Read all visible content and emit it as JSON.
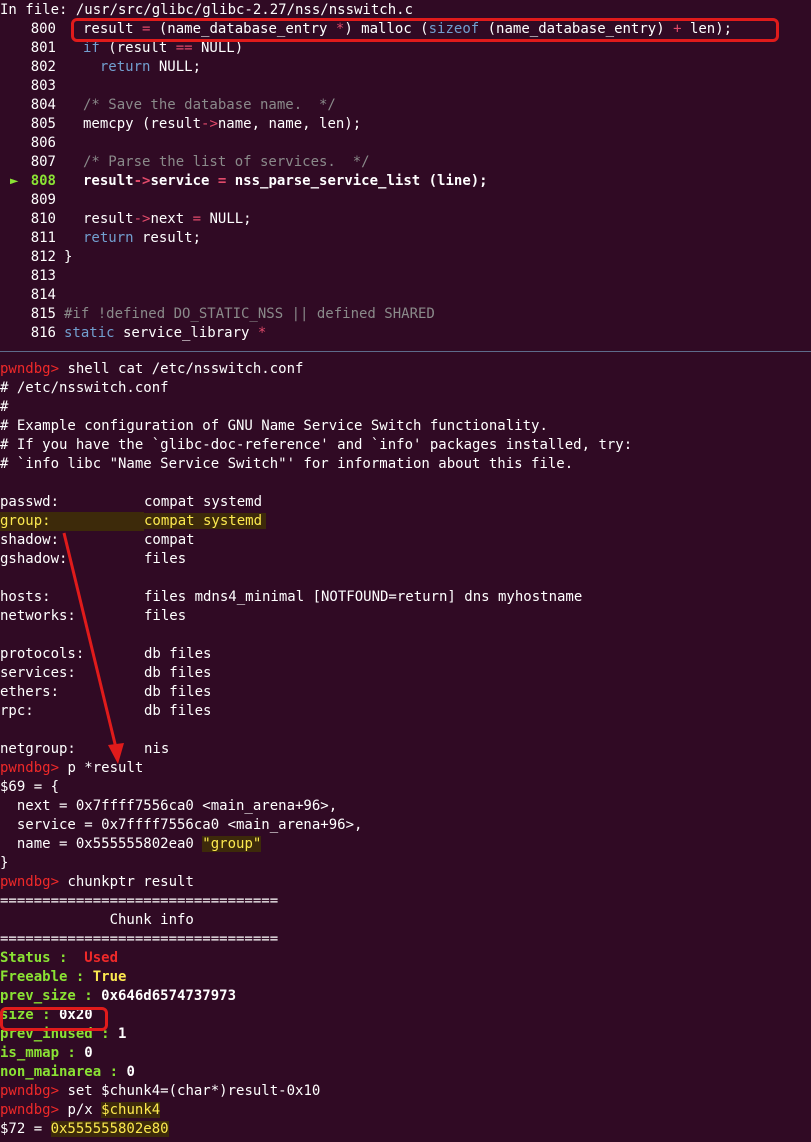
{
  "header": {
    "in_file": "In file: /usr/src/glibc/glibc-2.27/nss/nsswitch.c"
  },
  "source": {
    "current_marker": "►",
    "lines": [
      {
        "num": "800",
        "parts": [
          [
            "t",
            "result "
          ],
          [
            "op",
            "="
          ],
          [
            "t",
            " (name_database_entry "
          ],
          [
            "op",
            "*"
          ],
          [
            "t",
            ") malloc ("
          ],
          [
            "kw",
            "sizeof"
          ],
          [
            "t",
            " (name_database_entry) "
          ],
          [
            "op",
            "+"
          ],
          [
            "t",
            " len);"
          ]
        ]
      },
      {
        "num": "801",
        "parts": [
          [
            "kw",
            "if"
          ],
          [
            "t",
            " (result "
          ],
          [
            "op",
            "=="
          ],
          [
            "t",
            " NULL)"
          ]
        ]
      },
      {
        "num": "802",
        "parts": [
          [
            "t",
            "  "
          ],
          [
            "kw",
            "return"
          ],
          [
            "t",
            " NULL;"
          ]
        ]
      },
      {
        "num": "803",
        "parts": []
      },
      {
        "num": "804",
        "parts": [
          [
            "cm",
            "/* Save the database name.  */"
          ]
        ]
      },
      {
        "num": "805",
        "parts": [
          [
            "t",
            "memcpy (result"
          ],
          [
            "op",
            "->"
          ],
          [
            "t",
            "name, name, len);"
          ]
        ]
      },
      {
        "num": "806",
        "parts": []
      },
      {
        "num": "807",
        "parts": [
          [
            "cm",
            "/* Parse the list of services.  */"
          ]
        ]
      },
      {
        "num": "808",
        "parts": [
          [
            "t",
            "result"
          ],
          [
            "op",
            "->"
          ],
          [
            "t",
            "service "
          ],
          [
            "op",
            "="
          ],
          [
            "t",
            " nss_parse_service_list (line);"
          ]
        ]
      },
      {
        "num": "809",
        "parts": []
      },
      {
        "num": "810",
        "parts": [
          [
            "t",
            "result"
          ],
          [
            "op",
            "->"
          ],
          [
            "t",
            "next "
          ],
          [
            "op",
            "="
          ],
          [
            "t",
            " NULL;"
          ]
        ]
      },
      {
        "num": "811",
        "parts": [
          [
            "kw",
            "return"
          ],
          [
            "t",
            " result;"
          ]
        ]
      },
      {
        "num": "812",
        "parts": [
          [
            "t",
            "}"
          ]
        ]
      },
      {
        "num": "813",
        "parts": []
      },
      {
        "num": "814",
        "parts": []
      },
      {
        "num": "815",
        "parts": [
          [
            "cm",
            "#if !defined DO_STATIC_NSS || defined SHARED"
          ]
        ]
      },
      {
        "num": "816",
        "parts": [
          [
            "kw",
            "static"
          ],
          [
            "t",
            " service_library "
          ],
          [
            "op",
            "*"
          ]
        ]
      }
    ]
  },
  "terminal": {
    "prompt": "pwndbg>",
    "cmd1": " shell cat /etc/nsswitch.conf",
    "conf_comments": [
      "# /etc/nsswitch.conf",
      "#",
      "# Example configuration of GNU Name Service Switch functionality.",
      "# If you have the `glibc-doc-reference' and `info' packages installed, try:",
      "# `info libc \"Name Service Switch\"' for information about this file."
    ],
    "conf_group1": [
      [
        "passwd:",
        "compat systemd"
      ],
      [
        "group:",
        "compat systemd"
      ],
      [
        "shadow:",
        "compat"
      ],
      [
        "gshadow:",
        "files"
      ]
    ],
    "conf_group2": [
      [
        "hosts:",
        "files mdns4_minimal [NOTFOUND=return] dns myhostname"
      ],
      [
        "networks:",
        "files"
      ]
    ],
    "conf_group3": [
      [
        "protocols:",
        "db files"
      ],
      [
        "services:",
        "db files"
      ],
      [
        "ethers:",
        "db files"
      ],
      [
        "rpc:",
        "db files"
      ]
    ],
    "conf_group4": [
      [
        "netgroup:",
        "nis"
      ]
    ],
    "cmd2": " p *result",
    "p_open": "$69 = {",
    "p_next": "  next = 0x7ffff7556ca0 <main_arena+96>,",
    "p_service": "  service = 0x7ffff7556ca0 <main_arena+96>,",
    "p_name_prefix": "  name = 0x555555802ea0 ",
    "p_name_value": "\"group\"",
    "p_close": "}",
    "cmd3": " chunkptr result",
    "equals": "=================================",
    "chunk_title": "             Chunk info",
    "status_key": "Status :",
    "status_val": "  Used",
    "freeable_key": "Freeable :",
    "freeable_val": " True",
    "fields": [
      [
        "prev_size :",
        " 0x646d6574737973"
      ],
      [
        "size :",
        " 0x20"
      ],
      [
        "prev_inused :",
        " 1"
      ],
      [
        "is_mmap :",
        " 0"
      ],
      [
        "non_mainarea :",
        " 0"
      ]
    ],
    "cmd4": " set $chunk4=(char*)result-0x10",
    "cmd5_prefix": " p/x ",
    "cmd5_var": "$chunk4",
    "result_prefix": "$72 = ",
    "result_val": "0x555555802e80"
  },
  "colors": {
    "background": "#300a24",
    "annotation": "#e01b1b",
    "current_line": "#8ae234",
    "prompt": "#ef2929"
  }
}
